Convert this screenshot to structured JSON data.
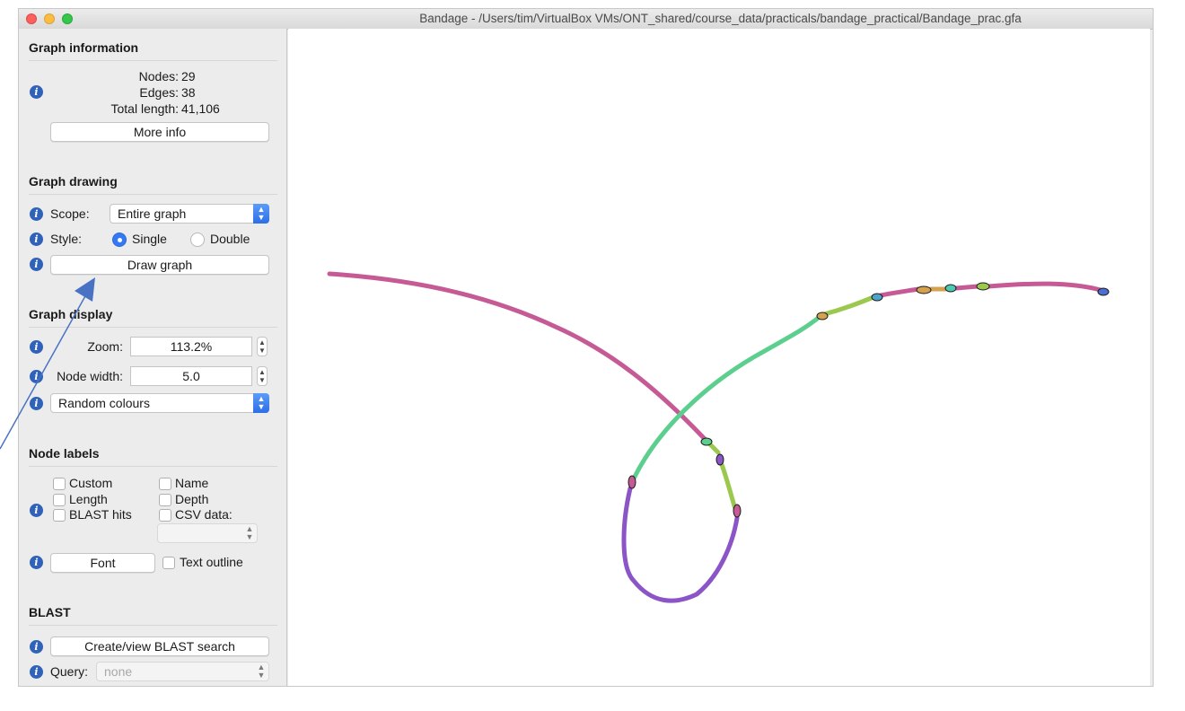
{
  "window": {
    "title": "Bandage - /Users/tim/VirtualBox VMs/ONT_shared/course_data/practicals/bandage_practical/Bandage_prac.gfa"
  },
  "graph_information": {
    "title": "Graph information",
    "nodes_label": "Nodes:",
    "nodes_value": "29",
    "edges_label": "Edges:",
    "edges_value": "38",
    "length_label": "Total length:",
    "length_value": "41,106",
    "more_info": "More info"
  },
  "graph_drawing": {
    "title": "Graph drawing",
    "scope_label": "Scope:",
    "scope_value": "Entire graph",
    "style_label": "Style:",
    "style_single": "Single",
    "style_double": "Double",
    "style_selected": "Single",
    "draw_button": "Draw graph"
  },
  "graph_display": {
    "title": "Graph display",
    "zoom_label": "Zoom:",
    "zoom_value": "113.2%",
    "node_width_label": "Node width:",
    "node_width_value": "5.0",
    "colour_scheme": "Random colours"
  },
  "node_labels": {
    "title": "Node labels",
    "custom": "Custom",
    "name": "Name",
    "length": "Length",
    "depth": "Depth",
    "blast_hits": "BLAST hits",
    "csv_data": "CSV data:",
    "font_button": "Font",
    "text_outline": "Text outline"
  },
  "blast": {
    "title": "BLAST",
    "search_button": "Create/view BLAST search",
    "query_label": "Query:",
    "query_value": "none"
  },
  "colors": {
    "accent": "#3478f6",
    "info_icon": "#2f62b8",
    "annotation_arrow": "#4a72c4",
    "segment_pink": "#c65a94",
    "segment_green": "#5ccf8e",
    "segment_lightgreen": "#9bc84e",
    "segment_purple": "#8b55c8"
  }
}
